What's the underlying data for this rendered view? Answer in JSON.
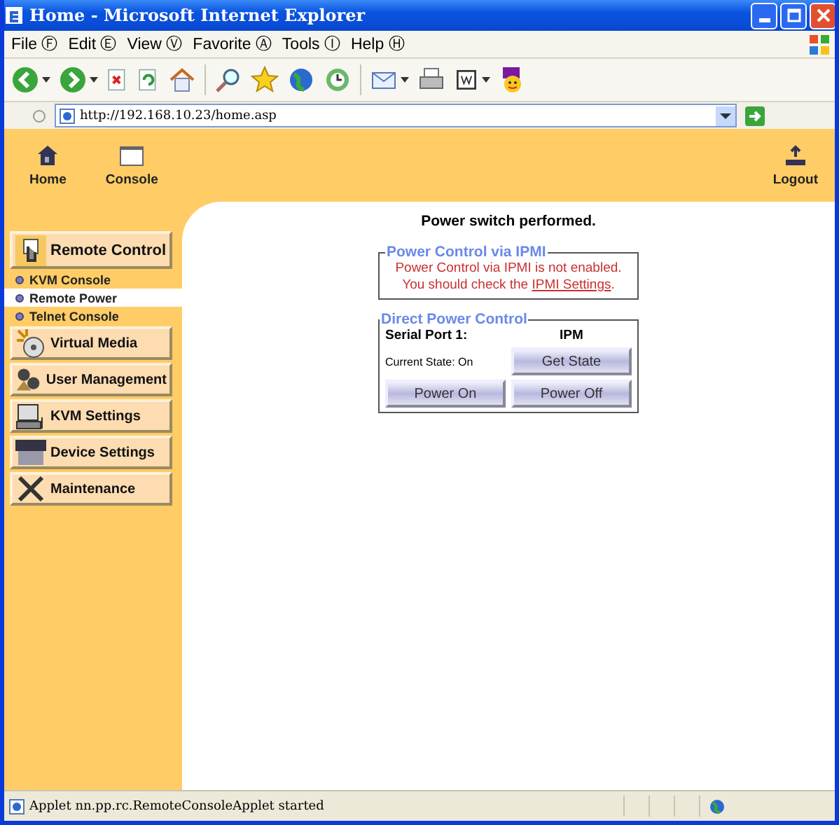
{
  "window": {
    "title": "Home - Microsoft Internet Explorer"
  },
  "menu": [
    "File Ⓕ",
    "Edit Ⓔ",
    "View Ⓥ",
    "Favorite Ⓐ",
    "Tools Ⓘ",
    "Help Ⓗ"
  ],
  "address": {
    "url": "http://192.168.10.23/home.asp"
  },
  "header": {
    "links": [
      {
        "label": "Home",
        "kind": "home"
      },
      {
        "label": "Console",
        "kind": "console"
      }
    ],
    "logout": "Logout"
  },
  "sidebar": {
    "groups": [
      {
        "label": "Remote Control",
        "kind": "remote",
        "expanded": true,
        "children": [
          {
            "label": "KVM Console",
            "selected": false
          },
          {
            "label": "Remote Power",
            "selected": true
          },
          {
            "label": "Telnet Console",
            "selected": false
          }
        ]
      },
      {
        "label": "Virtual Media",
        "kind": "media",
        "expanded": false
      },
      {
        "label": "User Management",
        "kind": "users",
        "expanded": false
      },
      {
        "label": "KVM Settings",
        "kind": "kvm",
        "expanded": false
      },
      {
        "label": "Device Settings",
        "kind": "device",
        "expanded": false
      },
      {
        "label": "Maintenance",
        "kind": "tools",
        "expanded": false
      }
    ]
  },
  "content": {
    "message": "Power switch performed.",
    "ipmi": {
      "legend": "Power Control via IPMI",
      "line1": "Power Control via IPMI is not enabled.",
      "line2": "You should check the",
      "link": "IPMI Settings",
      "after": "."
    },
    "direct": {
      "legend": "Direct Power Control",
      "port_label": "Serial Port 1:",
      "port_value": "IPM",
      "state": "Current State: On",
      "buttons": {
        "get_state": "Get State",
        "power_on": "Power On",
        "power_off": "Power Off"
      }
    }
  },
  "status_bar": {
    "text": "Applet nn.pp.rc.RemoteConsoleApplet started"
  }
}
